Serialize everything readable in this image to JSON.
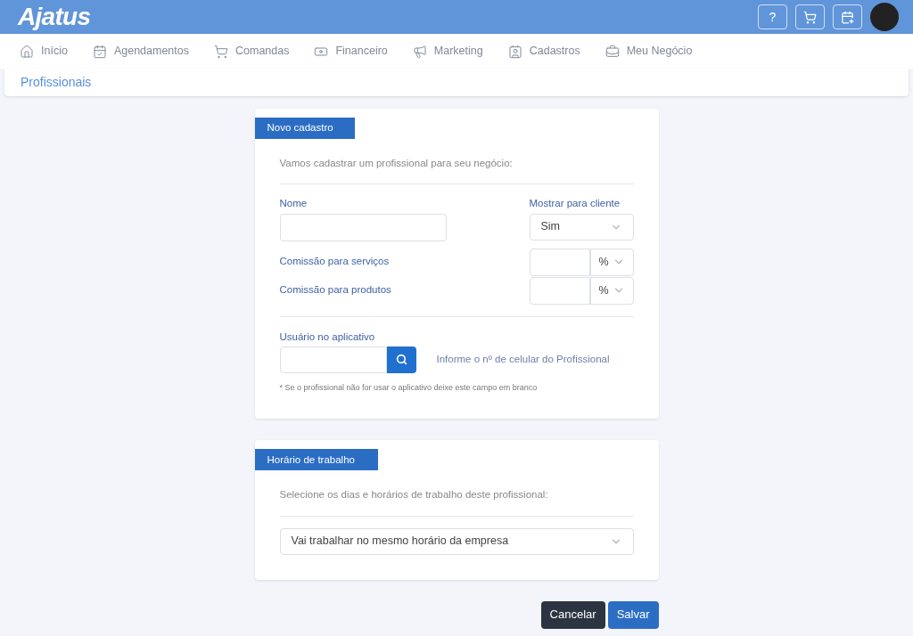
{
  "header": {
    "logo": "Ajatus",
    "help": "?"
  },
  "nav": [
    {
      "label": "Início",
      "kind": "home"
    },
    {
      "label": "Agendamentos",
      "kind": "schedule"
    },
    {
      "label": "Comandas",
      "kind": "orders"
    },
    {
      "label": "Financeiro",
      "kind": "finance"
    },
    {
      "label": "Marketing",
      "kind": "marketing"
    },
    {
      "label": "Cadastros",
      "kind": "records"
    },
    {
      "label": "Meu Negócio",
      "kind": "business"
    }
  ],
  "page_title": "Profissionais",
  "new_card": {
    "tab": "Novo cadastro",
    "intro": "Vamos cadastrar um profissional para seu negócio:",
    "name_label": "Nome",
    "show_label": "Mostrar para cliente",
    "show_value": "Sim",
    "commissions": [
      {
        "label": "Comissão para serviços",
        "unit": "%"
      },
      {
        "label": "Comissão para produtos",
        "unit": "%"
      }
    ],
    "app_user_label": "Usuário no aplicativo",
    "app_user_hint": "Informe o nº de celular do Profissional",
    "footnote": "* Se o profissional não for usar o aplicativo deixe este campo em branco"
  },
  "schedule_card": {
    "tab": "Horário de trabalho",
    "intro": "Selecione os dias e horários de trabalho deste profissional:",
    "value": "Vai trabalhar no mesmo horário da empresa"
  },
  "buttons": [
    {
      "label": "Cancelar",
      "kind": "secondary"
    },
    {
      "label": "Salvar",
      "kind": "primary"
    }
  ]
}
